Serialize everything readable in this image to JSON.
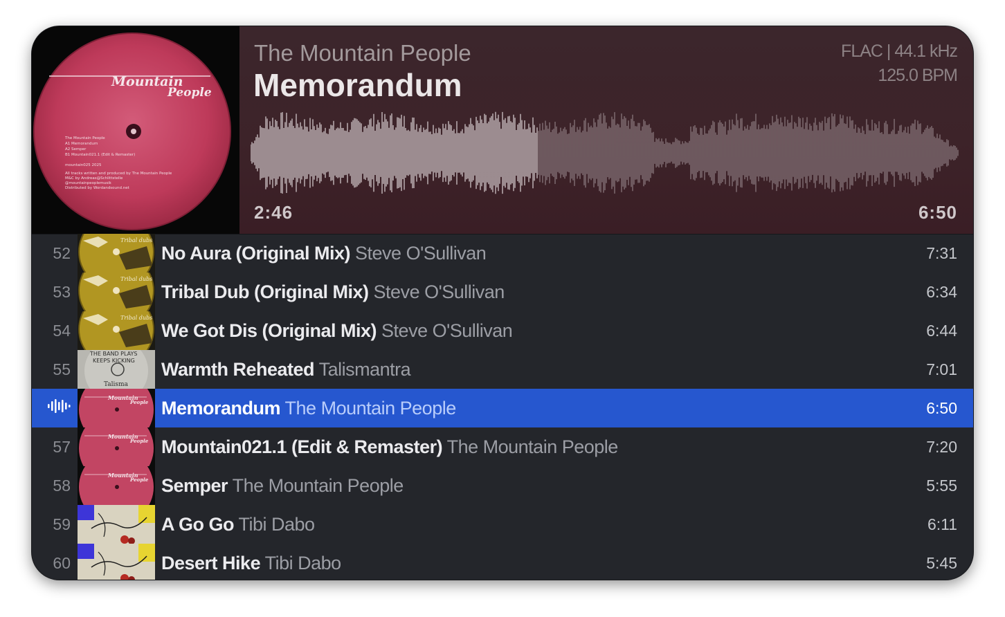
{
  "now_playing": {
    "artist": "The Mountain People",
    "title": "Memorandum",
    "format": "FLAC | 44.1 kHz",
    "bpm": "125.0 BPM",
    "elapsed": "2:46",
    "duration": "6:50",
    "progress_fraction": 0.405,
    "cover_icon": "vinyl-record-icon",
    "cover_text": {
      "logo": "Mountain People",
      "lines": [
        "The Mountain People",
        "A1 Memorandum",
        "A2 Semper",
        "B1 Mountain021.1 (Edit & Remaster)",
        "mountain025 2025",
        "All tracks written and produced by The Mountain People",
        "M&C by Andreas@Schlittstelle",
        "@mountainpeoplemusik",
        "Distributed by Wordandsound.net"
      ]
    }
  },
  "colors": {
    "header_bg": "#3c262c",
    "list_bg": "#24262b",
    "selection": "#2657cf",
    "waveform_played": "#dcd3d5",
    "waveform_unplayed": "#8e7d82"
  },
  "playlist": [
    {
      "num": "52",
      "title": "No Aura (Original Mix)",
      "artist": "Steve O'Sullivan",
      "duration": "7:31",
      "cover": "tribal-dubs"
    },
    {
      "num": "53",
      "title": "Tribal Dub (Original Mix)",
      "artist": "Steve O'Sullivan",
      "duration": "6:34",
      "cover": "tribal-dubs"
    },
    {
      "num": "54",
      "title": "We Got Dis (Original Mix)",
      "artist": "Steve O'Sullivan",
      "duration": "6:44",
      "cover": "tribal-dubs"
    },
    {
      "num": "55",
      "title": "Warmth Reheated",
      "artist": "Talismantra",
      "duration": "7:01",
      "cover": "talismantra"
    },
    {
      "num": "",
      "title": "Memorandum",
      "artist": "The Mountain People",
      "duration": "6:50",
      "cover": "mountain-people",
      "playing": true,
      "indicator_icon": "now-playing-bars-icon"
    },
    {
      "num": "57",
      "title": "Mountain021.1 (Edit & Remaster)",
      "artist": "The Mountain People",
      "duration": "7:20",
      "cover": "mountain-people"
    },
    {
      "num": "58",
      "title": "Semper",
      "artist": "The Mountain People",
      "duration": "5:55",
      "cover": "mountain-people"
    },
    {
      "num": "59",
      "title": "A Go Go",
      "artist": "Tibi Dabo",
      "duration": "6:11",
      "cover": "tibi-dabo"
    },
    {
      "num": "60",
      "title": "Desert Hike",
      "artist": "Tibi Dabo",
      "duration": "5:45",
      "cover": "tibi-dabo"
    }
  ]
}
